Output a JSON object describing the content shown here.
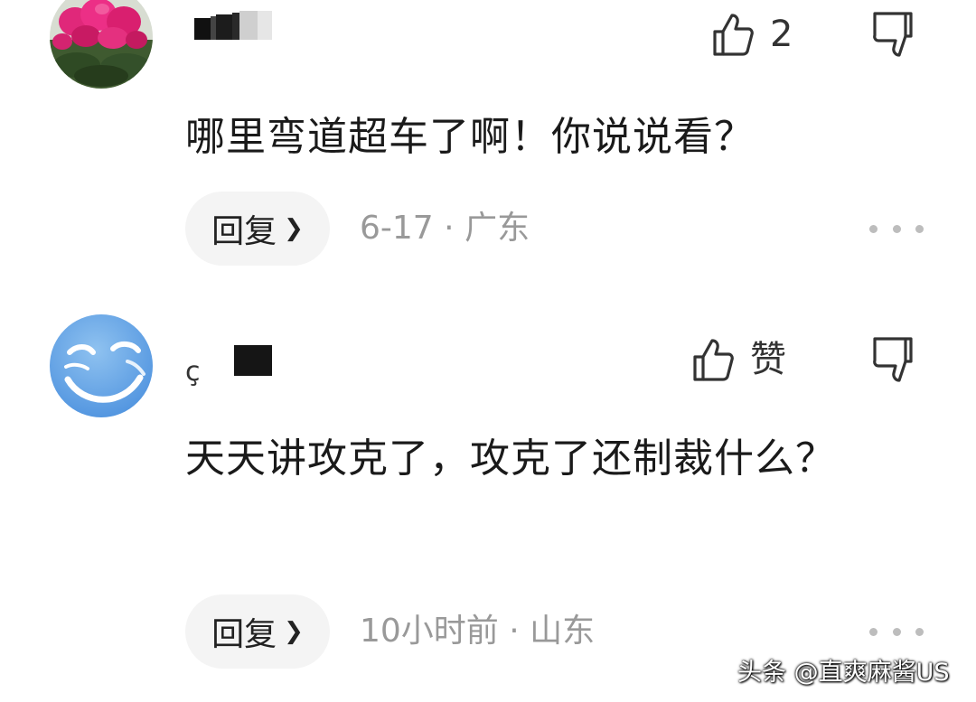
{
  "comments": [
    {
      "username": "",
      "like_count": "2",
      "text": "哪里弯道超车了啊！你说说看？",
      "reply_label": "回复",
      "date": "6-17",
      "location": "广东"
    },
    {
      "username": "ç",
      "like_count": "赞",
      "text": "天天讲攻克了，攻克了还制裁什么？",
      "reply_label": "回复",
      "date": "10小时前",
      "location": "山东"
    }
  ],
  "icons": {
    "like": "thumbs-up-icon",
    "dislike": "thumbs-down-icon",
    "more": "more-horizontal-icon",
    "reply_arrow": "chevron-right-icon"
  },
  "meta_separator": "·",
  "watermark": "头条 @直爽麻酱US",
  "colors": {
    "text_primary": "#1a1a1a",
    "text_secondary": "#999999",
    "pill_background": "#f4f4f4",
    "dot": "#bdbdbd"
  }
}
